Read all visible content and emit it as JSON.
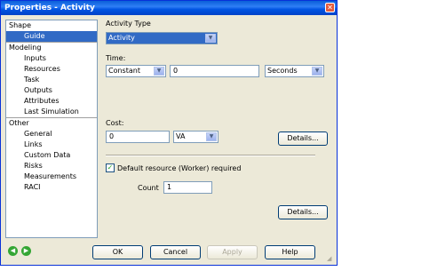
{
  "window": {
    "title": "Properties - Activity",
    "close_icon": "x-icon"
  },
  "nav": {
    "groups": [
      {
        "label": "Shape",
        "items": [
          "Guide"
        ]
      },
      {
        "label": "Modeling",
        "items": [
          "Inputs",
          "Resources",
          "Task",
          "Outputs",
          "Attributes",
          "Last Simulation"
        ]
      },
      {
        "label": "Other",
        "items": [
          "General",
          "Links",
          "Custom Data",
          "Risks",
          "Measurements",
          "RACI"
        ]
      }
    ],
    "selected": "Guide"
  },
  "form": {
    "activity_type_label": "Activity Type",
    "activity_type_value": "Activity",
    "time_label": "Time:",
    "time_mode": "Constant",
    "time_value": "0",
    "time_unit": "Seconds",
    "cost_label": "Cost:",
    "cost_value": "0",
    "cost_unit": "VA",
    "details_label_1": "Details...",
    "default_resource_label": "Default resource (Worker) required",
    "default_resource_checked": true,
    "count_label": "Count",
    "count_value": "1",
    "details_label_2": "Details..."
  },
  "footer": {
    "ok": "OK",
    "cancel": "Cancel",
    "apply": "Apply",
    "help": "Help",
    "back_icon": "back-arrow-icon",
    "forward_icon": "forward-arrow-icon"
  }
}
